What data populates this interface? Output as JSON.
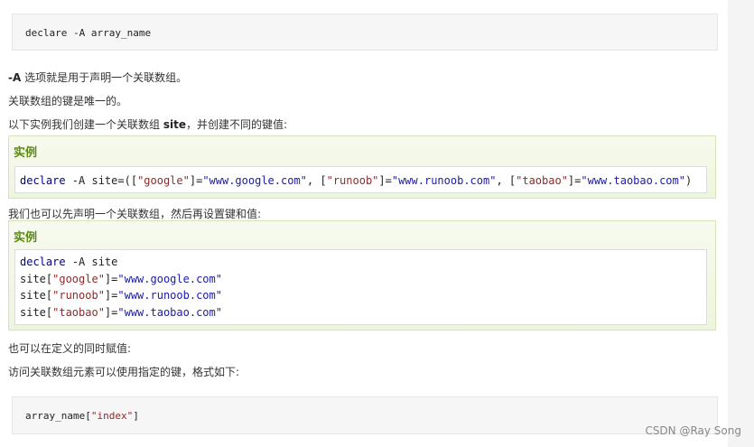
{
  "code1": {
    "line": "declare -A array_name"
  },
  "para1": {
    "prefix": "-A",
    "rest": " 选项就是用于声明一个关联数组。"
  },
  "para2": "关联数组的键是唯一的。",
  "para3": {
    "text1": "以下实例我们创建一个关联数组 ",
    "bold": "site",
    "text2": "，并创建不同的键值:"
  },
  "example1": {
    "title": "实例",
    "line": {
      "p1": "declare",
      "p2": " -A site=([",
      "p3": "\"google\"",
      "p4": "]=",
      "p5": "\"www.google.com\"",
      "p6": ", [",
      "p7": "\"runoob\"",
      "p8": "]=",
      "p9": "\"www.runoob.com\"",
      "p10": ", [",
      "p11": "\"taobao\"",
      "p12": "]=",
      "p13": "\"www.taobao.com\"",
      "p14": ")"
    }
  },
  "para4": "我们也可以先声明一个关联数组，然后再设置键和值:",
  "example2": {
    "title": "实例",
    "l1": {
      "kw": "declare",
      "rest": " -A site"
    },
    "l2": {
      "a": "site[",
      "b": "\"google\"",
      "c": "]=",
      "d": "\"www.google.com\""
    },
    "l3": {
      "a": "site[",
      "b": "\"runoob\"",
      "c": "]=",
      "d": "\"www.runoob.com\""
    },
    "l4": {
      "a": "site[",
      "b": "\"taobao\"",
      "c": "]=",
      "d": "\"www.taobao.com\""
    }
  },
  "para5": "也可以在定义的同时赋值:",
  "para6": "访问关联数组元素可以使用指定的键，格式如下:",
  "code2": {
    "a": "array_name[",
    "b": "\"index\"",
    "c": "]"
  },
  "watermark": "CSDN @Ray Song"
}
